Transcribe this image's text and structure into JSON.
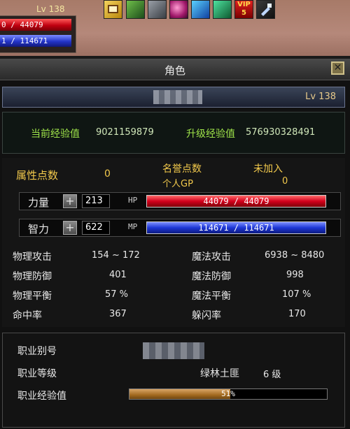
{
  "hud": {
    "level": "Lv 138",
    "hp_text": "0 / 44079",
    "mp_text": "1 / 114671",
    "icons": [
      "quest-board-icon",
      "skill-icon-1",
      "skill-icon-2",
      "skill-icon-3",
      "skill-icon-4",
      "skill-icon-5",
      "vip-icon",
      "tool-icon"
    ],
    "vip_label": "VIP",
    "vip_level": "5"
  },
  "window": {
    "title": "角色",
    "close_label": "✕"
  },
  "character": {
    "level": "Lv 138"
  },
  "experience": {
    "current_label": "当前经验值",
    "current_value": "9021159879",
    "next_label": "升级经验值",
    "next_value": "576930328491"
  },
  "stats": {
    "points_label": "属性点数",
    "points_value": "0",
    "fame_label": "名誉点数",
    "guild_status": "未加入",
    "gp_label": "个人GP",
    "gp_value": "0",
    "str_label": "力量",
    "str_value": "213",
    "hp_tag": "HP",
    "hp_text": "44079 / 44079",
    "int_label": "智力",
    "int_value": "622",
    "mp_tag": "MP",
    "mp_text": "114671 / 114671",
    "phys_atk_label": "物理攻击",
    "phys_atk_value": "154 ~ 172",
    "mag_atk_label": "魔法攻击",
    "mag_atk_value": "6938 ~ 8480",
    "phys_def_label": "物理防御",
    "phys_def_value": "401",
    "mag_def_label": "魔法防御",
    "mag_def_value": "998",
    "phys_bal_label": "物理平衡",
    "phys_bal_value": "57 %",
    "mag_bal_label": "魔法平衡",
    "mag_bal_value": "107 %",
    "hit_label": "命中率",
    "hit_value": "367",
    "dodge_label": "躲闪率",
    "dodge_value": "170"
  },
  "job": {
    "alias_label": "职业别号",
    "level_label": "职业等级",
    "class_name": "绿林土匪",
    "class_level": "6 级",
    "exp_label": "职业经验值",
    "exp_text": "51%",
    "exp_fraction": 0.51
  }
}
